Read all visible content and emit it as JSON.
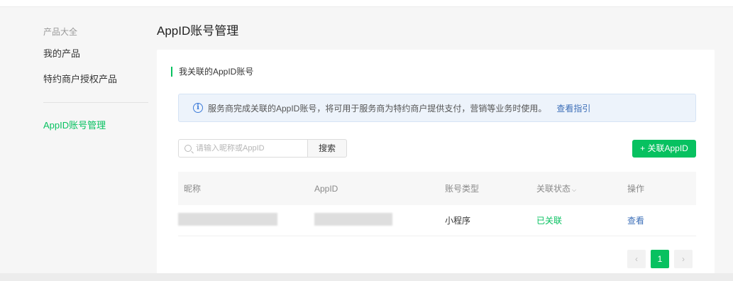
{
  "sidebar": {
    "group_title": "产品大全",
    "items": [
      {
        "label": "我的产品"
      },
      {
        "label": "特约商户授权产品"
      }
    ],
    "active_item": {
      "label": "AppID账号管理"
    }
  },
  "page": {
    "title": "AppID账号管理"
  },
  "section": {
    "title": "我关联的AppID账号"
  },
  "notice": {
    "text": "服务商完成关联的AppID账号，将可用于服务商为特约商户提供支付，营销等业务时使用。",
    "link": "查看指引",
    "icon": "i"
  },
  "search": {
    "placeholder": "请输入昵称或AppID",
    "button": "搜索"
  },
  "actions": {
    "add_button": "+ 关联AppID"
  },
  "table": {
    "columns": [
      "昵称",
      "AppID",
      "账号类型",
      "关联状态",
      "操作"
    ],
    "status_caret": "⌵",
    "rows": [
      {
        "type": "小程序",
        "status": "已关联",
        "action": "查看"
      }
    ]
  },
  "pagination": {
    "prev": "‹",
    "current": "1",
    "next": "›"
  },
  "colors": {
    "accent": "#07c160",
    "link": "#3d6fb8"
  }
}
